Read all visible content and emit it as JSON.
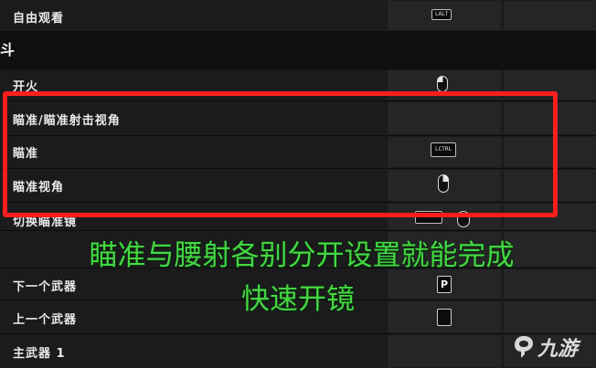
{
  "rows": {
    "free_look": {
      "label": "自由观看",
      "key": "LALT"
    },
    "section": {
      "label": "斗"
    },
    "fire": {
      "label": "开火"
    },
    "ads_toggle": {
      "label": "瞄准/瞄准射击视角"
    },
    "aim": {
      "label": "瞄准",
      "key": "LCTRL"
    },
    "aim_view": {
      "label": "瞄准视角"
    },
    "switch_sight": {
      "label": "切换瞄准镜"
    },
    "next_weapon": {
      "label": "下一个武器",
      "key": "P"
    },
    "prev_weapon": {
      "label": "上一个武器"
    },
    "primary_weapon": {
      "label": "主武器 1"
    }
  },
  "caption": {
    "line1": "瞄准与腰射各别分开设置就能完成",
    "line2": "快速开镜"
  },
  "logo": {
    "text": "九游"
  },
  "colors": {
    "highlight": "#ff1e1e",
    "caption": "#44d744",
    "row": "#1b1b1d",
    "cell": "#252527"
  },
  "icons": [
    "mouse-left-icon",
    "mouse-right-icon",
    "mouse-wheel-icon",
    "jiuyou-logo-icon"
  ]
}
